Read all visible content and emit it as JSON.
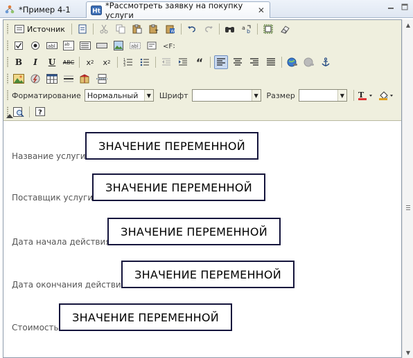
{
  "tabs": [
    {
      "label": "*Пример 4-1"
    },
    {
      "label": "*Рассмотреть заявку на покупку услуги"
    }
  ],
  "toolbar": {
    "source_label": "Источник",
    "format_label": "Форматирование",
    "format_value": "Нормальный",
    "font_label": "Шрифт",
    "font_value": "",
    "size_label": "Размер",
    "size_value": ""
  },
  "form": {
    "fields": [
      {
        "label": "Название услуги",
        "value": "ЗНАЧЕНИЕ ПЕРЕМЕННОЙ"
      },
      {
        "label": "Поставщик услуги",
        "value": "ЗНАЧЕНИЕ ПЕРЕМЕННОЙ"
      },
      {
        "label": "Дата начала действия",
        "value": "ЗНАЧЕНИЕ ПЕРЕМЕННОЙ"
      },
      {
        "label": "Дата окончания действия",
        "value": "ЗНАЧЕНИЕ ПЕРЕМЕННОЙ"
      },
      {
        "label": "Стоимость",
        "value": "ЗНАЧЕНИЕ ПЕРЕМЕННОЙ"
      }
    ]
  },
  "icons": {
    "tab1": "process-icon",
    "tab2": "html-form-icon",
    "close": "close-icon",
    "minimize": "minimize-icon",
    "maximize": "maximize-icon"
  },
  "colors": {
    "toolbar_bg": "#efefde",
    "value_border": "#14143c",
    "active_button": "#c9d9f0"
  }
}
